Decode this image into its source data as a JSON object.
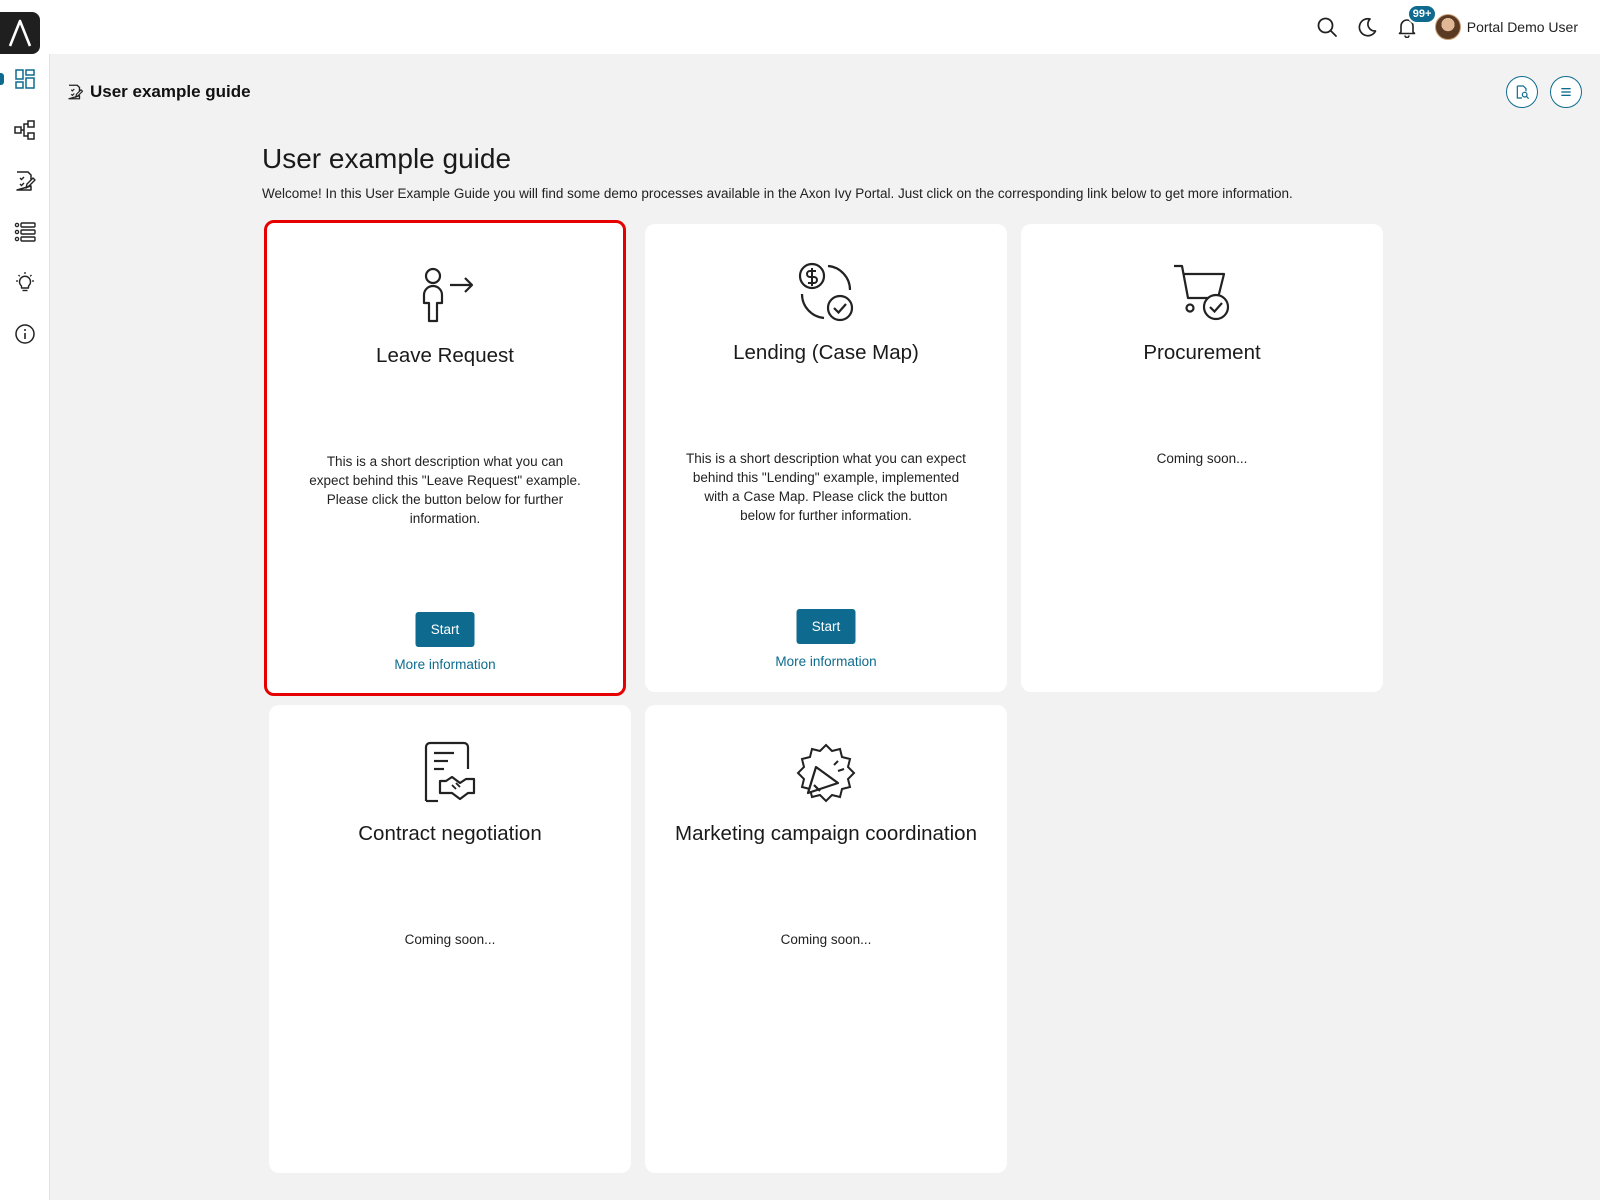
{
  "topbar": {
    "notifications_badge": "99+",
    "user_name": "Portal Demo User"
  },
  "page": {
    "header_title": "User example guide",
    "title": "User example guide",
    "description": "Welcome! In this User Example Guide you will find some demo processes available in the Axon Ivy Portal. Just click on the corresponding link below to get more information."
  },
  "cards": [
    {
      "title": "Leave Request",
      "icon": "person-leave-icon",
      "description": "This is a short description what you can expect behind this \"Leave Request\" example. Please click the button below for further information.",
      "start_label": "Start",
      "more_label": "More information"
    },
    {
      "title": "Lending (Case Map)",
      "icon": "money-exchange-icon",
      "description": "This is a short description what you can expect behind this \"Lending\" example, implemented with a Case Map. Please click the button below for further information.",
      "start_label": "Start",
      "more_label": "More information"
    },
    {
      "title": "Procurement",
      "icon": "cart-check-icon",
      "description": "Coming soon..."
    },
    {
      "title": "Contract negotiation",
      "icon": "contract-handshake-icon",
      "description": "Coming soon..."
    },
    {
      "title": "Marketing campaign coordination",
      "icon": "megaphone-badge-icon",
      "description": "Coming soon..."
    }
  ],
  "colors": {
    "accent": "#0e6b8f",
    "highlight": "#e60000",
    "background": "#f2f2f2"
  }
}
